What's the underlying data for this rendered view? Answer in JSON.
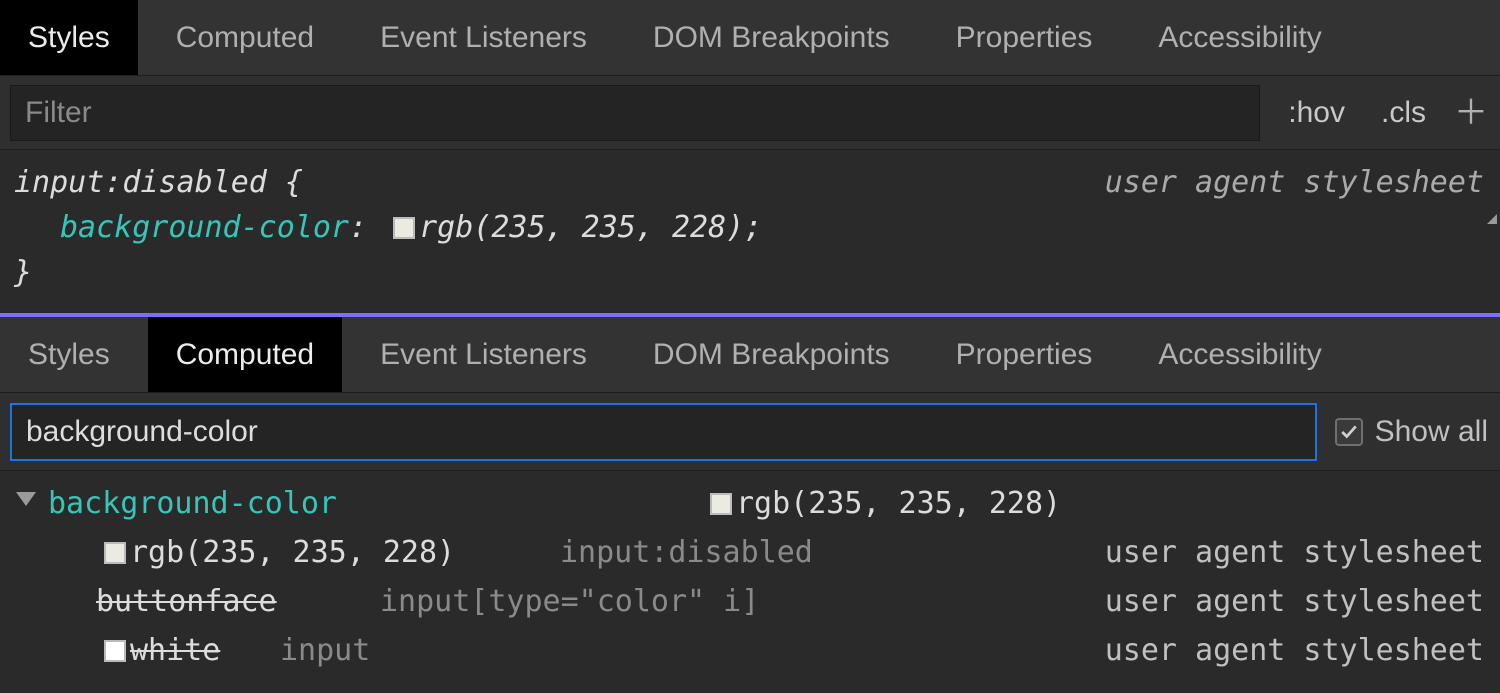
{
  "panel1": {
    "tabs": [
      "Styles",
      "Computed",
      "Event Listeners",
      "DOM Breakpoints",
      "Properties",
      "Accessibility"
    ],
    "active_index": 0,
    "filter_placeholder": "Filter",
    "hov_label": ":hov",
    "cls_label": ".cls",
    "rule": {
      "selector": "input:disabled",
      "open_brace": " {",
      "property": "background-color",
      "swatch_color": "rgb(235, 235, 228)",
      "value": "rgb(235, 235, 228);",
      "close_brace": "}",
      "origin": "user agent stylesheet"
    }
  },
  "panel2": {
    "tabs": [
      "Styles",
      "Computed",
      "Event Listeners",
      "DOM Breakpoints",
      "Properties",
      "Accessibility"
    ],
    "active_index": 1,
    "filter_value": "background-color",
    "show_all_label": "Show all",
    "show_all_checked": true,
    "computed": {
      "name": "background-color",
      "value": "rgb(235, 235, 228)",
      "swatch_color": "rgb(235, 235, 228)",
      "traces": [
        {
          "value": "rgb(235, 235, 228)",
          "swatch_color": "rgb(235, 235, 228)",
          "selector": "input:disabled",
          "origin": "user agent stylesheet",
          "struck": false
        },
        {
          "value": "buttonface",
          "swatch_color": null,
          "selector": "input[type=\"color\" i]",
          "origin": "user agent stylesheet",
          "struck": true
        },
        {
          "value": "white",
          "swatch_color": "white",
          "selector": "input",
          "origin": "user agent stylesheet",
          "struck": true
        }
      ]
    }
  }
}
